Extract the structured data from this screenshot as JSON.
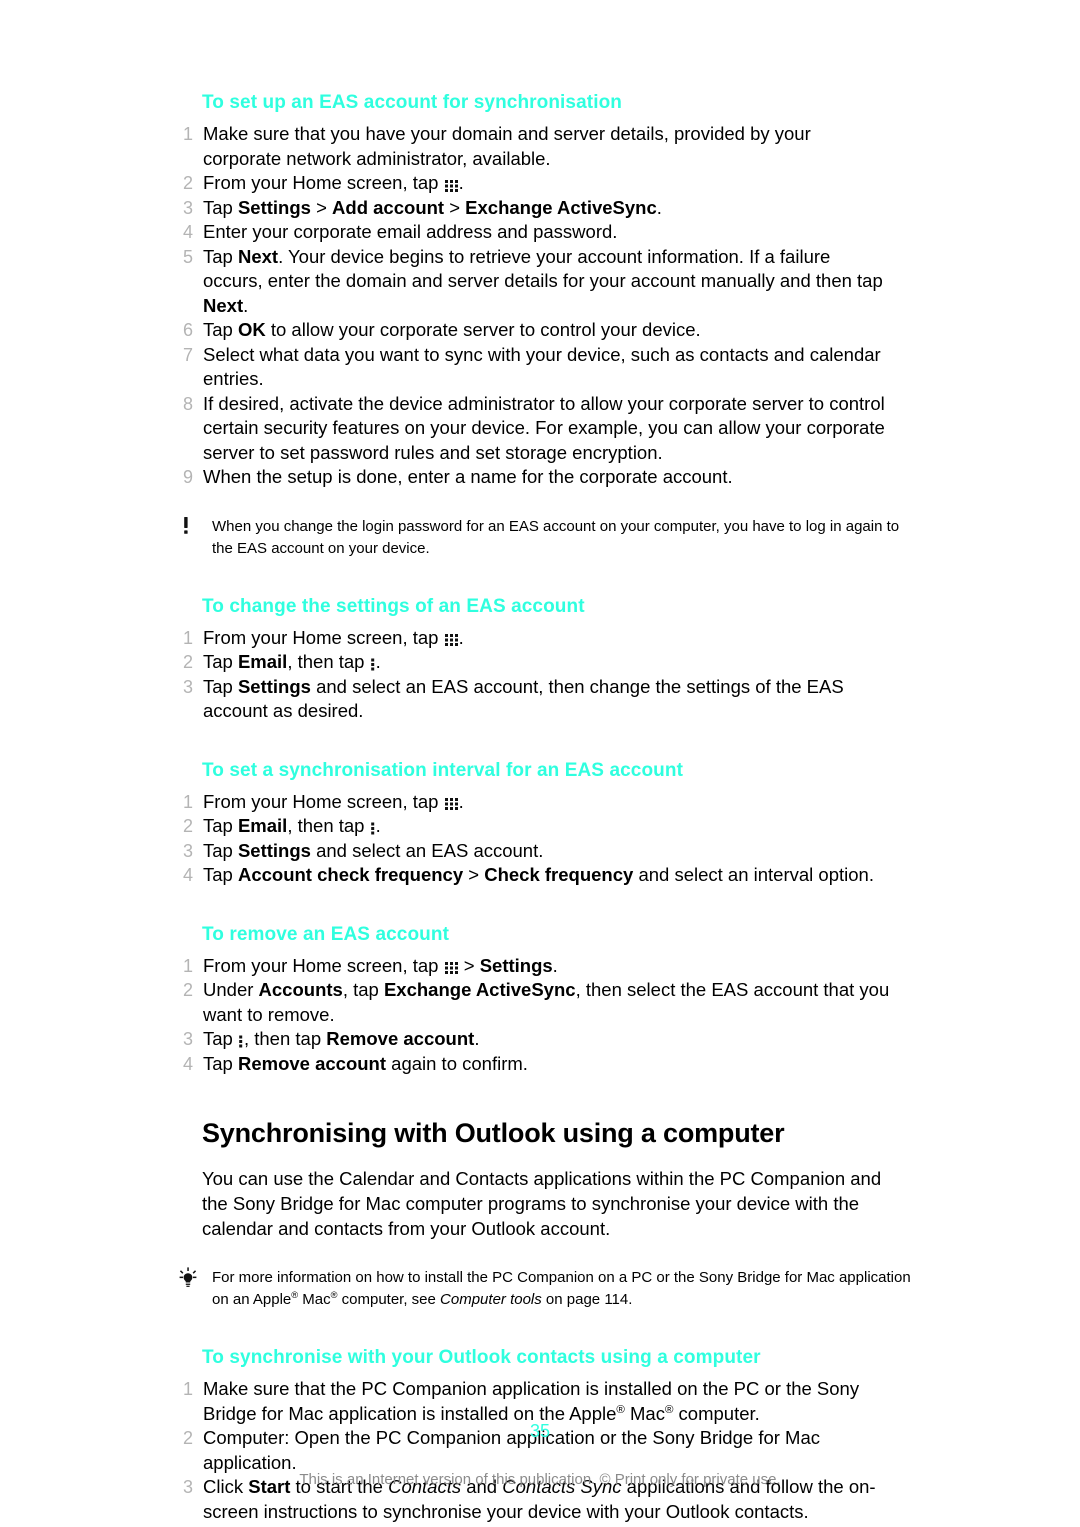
{
  "page": {
    "number": "35",
    "footer_note": "This is an Internet version of this publication. © Print only for private use.",
    "accent_color": "#2fffdf",
    "step_number_color": "#b4b4b4",
    "footer_color": "#8b8b8b"
  },
  "sections": {
    "eas_setup": {
      "heading": "To set up an EAS account for synchronisation",
      "steps": [
        {
          "num": "1",
          "text": "Make sure that you have your domain and server details, provided by your corporate network administrator, available."
        },
        {
          "num": "2",
          "text_before": "From your Home screen, tap ",
          "icon": "app-grid-icon",
          "text_after": "."
        },
        {
          "num": "3",
          "text": "Tap Settings > Add account > Exchange ActiveSync."
        },
        {
          "num": "4",
          "text": "Enter your corporate email address and password."
        },
        {
          "num": "5",
          "text": "Tap Next. Your device begins to retrieve your account information. If a failure occurs, enter the domain and server details for your account manually and then tap Next."
        },
        {
          "num": "6",
          "text": "Tap OK to allow your corporate server to control your device."
        },
        {
          "num": "7",
          "text": "Select what data you want to sync with your device, such as contacts and calendar entries."
        },
        {
          "num": "8",
          "text": "If desired, activate the device administrator to allow your corporate server to control certain security features on your device. For example, you can allow your corporate server to set password rules and set storage encryption."
        },
        {
          "num": "9",
          "text": "When the setup is done, enter a name for the corporate account."
        }
      ]
    },
    "note_password": {
      "icon": "exclamation-icon",
      "text": "When you change the login password for an EAS account on your computer, you have to log in again to the EAS account on your device."
    },
    "eas_change_settings": {
      "heading": "To change the settings of an EAS account",
      "steps": [
        {
          "num": "1",
          "text_before": "From your Home screen, tap ",
          "icon": "app-grid-icon",
          "text_after": "."
        },
        {
          "num": "2",
          "text_before": "Tap Email, then tap ",
          "icon": "overflow-menu-icon",
          "text_after": "."
        },
        {
          "num": "3",
          "text": "Tap Settings and select an EAS account, then change the settings of the EAS account as desired."
        }
      ]
    },
    "eas_sync_interval": {
      "heading": "To set a synchronisation interval for an EAS account",
      "steps": [
        {
          "num": "1",
          "text_before": "From your Home screen, tap ",
          "icon": "app-grid-icon",
          "text_after": "."
        },
        {
          "num": "2",
          "text_before": "Tap Email, then tap ",
          "icon": "overflow-menu-icon",
          "text_after": "."
        },
        {
          "num": "3",
          "text": "Tap Settings and select an EAS account."
        },
        {
          "num": "4",
          "text": "Tap Account check frequency > Check frequency and select an interval option."
        }
      ]
    },
    "eas_remove": {
      "heading": "To remove an EAS account",
      "steps": [
        {
          "num": "1",
          "text_before": "From your Home screen, tap ",
          "icon": "app-grid-icon",
          "text_after": " > Settings."
        },
        {
          "num": "2",
          "text": "Under Accounts, tap Exchange ActiveSync, then select the EAS account that you want to remove."
        },
        {
          "num": "3",
          "text_before": "Tap ",
          "icon": "overflow-menu-icon",
          "text_after": ", then tap Remove account."
        },
        {
          "num": "4",
          "text": "Tap Remove account again to confirm."
        }
      ]
    },
    "outlook": {
      "heading": "Synchronising with Outlook using a computer",
      "intro": "You can use the Calendar and Contacts applications within the PC Companion and the Sony Bridge for Mac computer programs to synchronise your device with the calendar and contacts from your Outlook account.",
      "tip": {
        "icon": "lightbulb-icon",
        "text": "For more information on how to install the PC Companion on a PC or the Sony Bridge for Mac application on an Apple® Mac® computer, see Computer tools on page 114."
      },
      "sub_heading": "To synchronise with your Outlook contacts using a computer",
      "steps": [
        {
          "num": "1",
          "text": "Make sure that the PC Companion application is installed on the PC or the Sony Bridge for Mac application is installed on the Apple® Mac® computer."
        },
        {
          "num": "2",
          "text": "Computer: Open the PC Companion application or the Sony Bridge for Mac application."
        },
        {
          "num": "3",
          "text": "Click Start to start the Contacts and Contacts Sync applications and follow the on-screen instructions to synchronise your device with your Outlook contacts."
        }
      ]
    }
  }
}
